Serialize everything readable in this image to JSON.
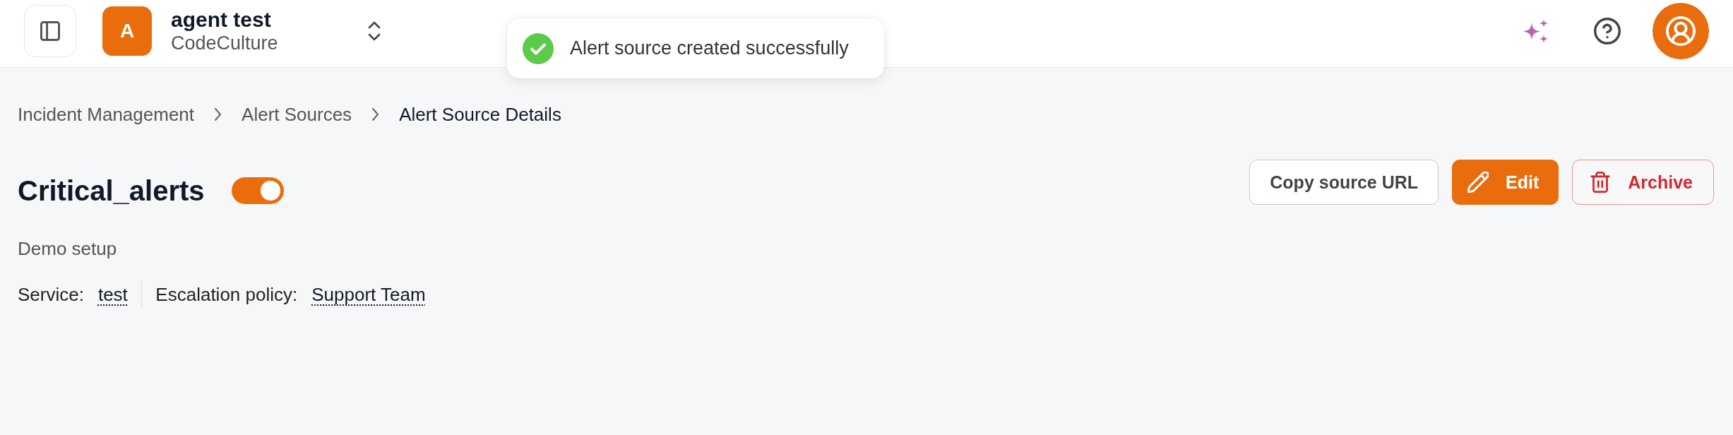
{
  "header": {
    "workspace": {
      "initial": "A",
      "name": "agent test",
      "org": "CodeCulture"
    }
  },
  "toast": {
    "kind": "success",
    "message": "Alert source created successfully"
  },
  "breadcrumb": [
    {
      "label": "Incident Management",
      "current": false
    },
    {
      "label": "Alert Sources",
      "current": false
    },
    {
      "label": "Alert Source Details",
      "current": true
    }
  ],
  "title": "Critical_alerts",
  "enabled": true,
  "actions": [
    {
      "kind": "outline",
      "label": "Copy source URL"
    },
    {
      "kind": "primary",
      "label": "Edit"
    },
    {
      "kind": "danger",
      "label": "Archive"
    }
  ],
  "description": "Demo setup",
  "meta": [
    {
      "label": "Service:",
      "value": "test"
    },
    {
      "label": "Escalation policy:",
      "value": "Support Team"
    }
  ]
}
